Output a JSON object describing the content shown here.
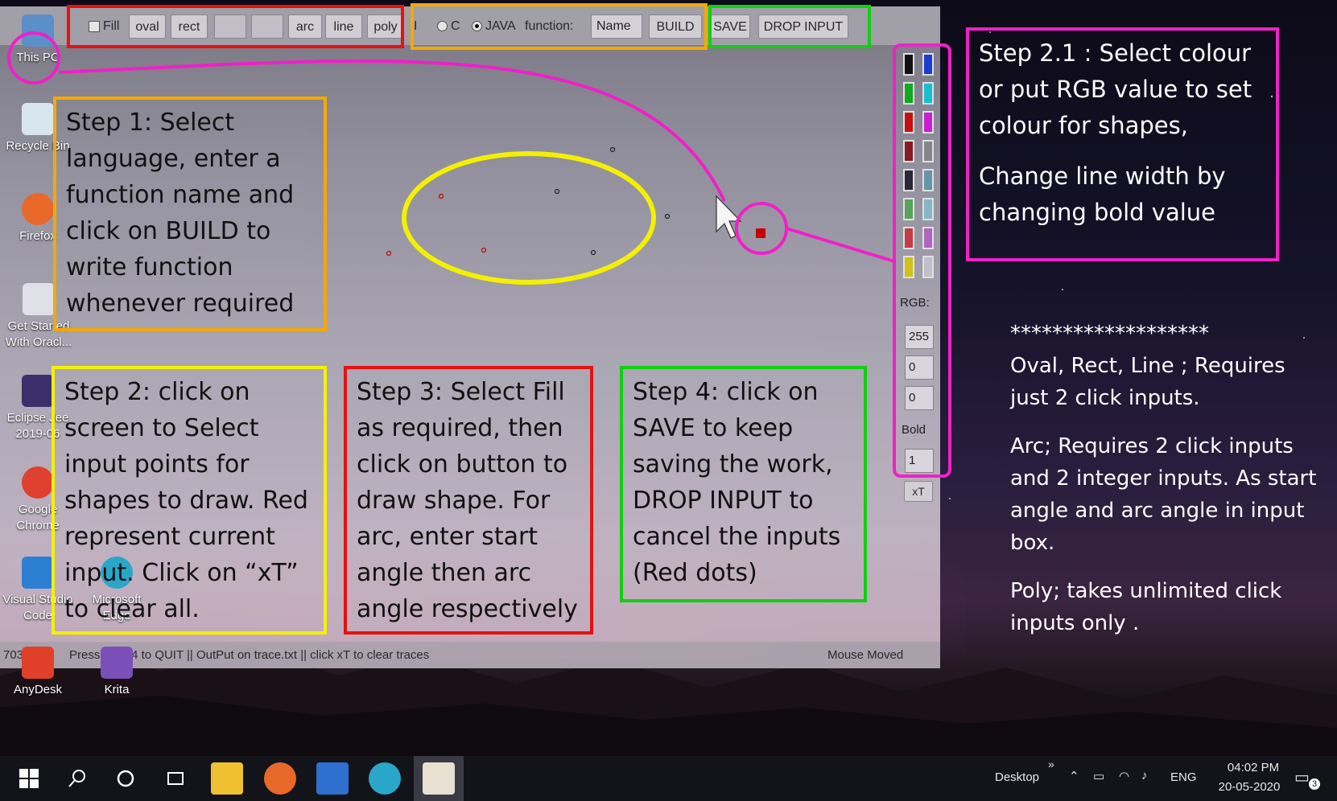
{
  "desktop_icons": [
    {
      "label": "This PC"
    },
    {
      "label": "Recycle Bin"
    },
    {
      "label": "Firefox"
    },
    {
      "label": "Get Started With Oracl..."
    },
    {
      "label": "Eclipse Jee 2019-06"
    },
    {
      "label": "Google Chrome"
    },
    {
      "label": "Visual Studio Code"
    },
    {
      "label": "Microsoft Edge"
    },
    {
      "label": "AnyDesk"
    },
    {
      "label": "Krita"
    }
  ],
  "toolbar": {
    "fill_label": "Fill",
    "oval_label": "oval",
    "rect_label": "rect",
    "input1_value": "",
    "input2_value": "",
    "arc_label": "arc",
    "line_label": "line",
    "poly_label": "poly",
    "sep": "I",
    "lang_c_label": "C",
    "lang_java_label": "JAVA",
    "function_label": "function:",
    "function_value": "Name",
    "build_label": "BUILD",
    "save_label": "SAVE",
    "drop_input_label": "DROP INPUT"
  },
  "palette": {
    "colors": [
      "#111111",
      "#1b3fd6",
      "#10b020",
      "#18c7d8",
      "#d01010",
      "#d020d8",
      "#8a1c24",
      "#8a8a90",
      "#2a2a3a",
      "#6a9ab0",
      "#5aaa5a",
      "#8abcd0",
      "#c84048",
      "#b868c8",
      "#d8c818",
      "#c8c8d0"
    ],
    "rgb_label": "RGB:",
    "r_value": "255",
    "g_value": "0",
    "b_value": "0",
    "bold_label": "Bold",
    "bold_value": "1",
    "clear_label": "xT"
  },
  "statusbar": {
    "coords": "703,182",
    "message": "Press Alt+F4 to QUIT || OutPut on trace.txt || click xT to clear traces",
    "event": "Mouse Moved"
  },
  "annotations": {
    "step1": "Step 1: Select language, enter a function name and click on BUILD to write function whenever required",
    "step2": "Step 2: click on screen to Select input points for shapes to draw. Red represent current input. Click on “xT” to clear all.",
    "step3": "Step 3: Select Fill as required, then click on button to draw shape. For arc, enter start angle then arc angle respectively",
    "step4": "Step 4: click on SAVE to keep saving the work, DROP INPUT to cancel the inputs (Red dots)",
    "step21": "Step 2.1 : Select colour or put RGB value to set colour for shapes,",
    "step21b": "Change line width by changing bold value",
    "stars_line": "*******************",
    "note1": "Oval, Rect, Line ; Requires just 2 click inputs.",
    "note2": "Arc; Requires 2 click inputs and 2 integer inputs. As start angle and arc angle in input box.",
    "note3": "Poly; takes unlimited click inputs only ."
  },
  "taskbar": {
    "desktop_label": "Desktop",
    "lang": "ENG",
    "time": "04:02 PM",
    "date": "20-05-2020",
    "notification_count": "3"
  },
  "colors": {
    "red_box": "#e81010",
    "orange_box": "#f5a800",
    "green_box": "#10d010",
    "magenta_box": "#f020c8",
    "yellow_box": "#f5f000"
  }
}
